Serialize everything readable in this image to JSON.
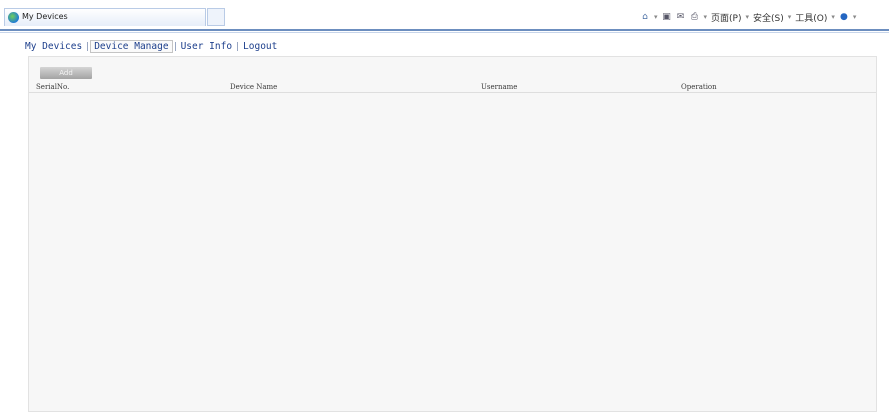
{
  "browser": {
    "tab_title": "My Devices",
    "commands": {
      "page": "页面(P)",
      "safety": "安全(S)",
      "tools": "工具(O)"
    }
  },
  "nav": {
    "items": [
      {
        "label": "My Devices"
      },
      {
        "label": "Device Manage"
      },
      {
        "label": "User Info"
      },
      {
        "label": "Logout"
      }
    ],
    "active_index": 1
  },
  "toolbar": {
    "add_label": "Add"
  },
  "table": {
    "columns": [
      "SerialNo.",
      "Device Name",
      "Username",
      "Operation"
    ],
    "rows": []
  },
  "colors": {
    "nav_text": "#1d3f8c",
    "panel_bg": "#f7f7f7",
    "rule": "#6c8ebf"
  },
  "icons": [
    "favicon-icon",
    "home-icon",
    "feeds-icon",
    "mail-icon",
    "print-icon",
    "help-icon"
  ]
}
